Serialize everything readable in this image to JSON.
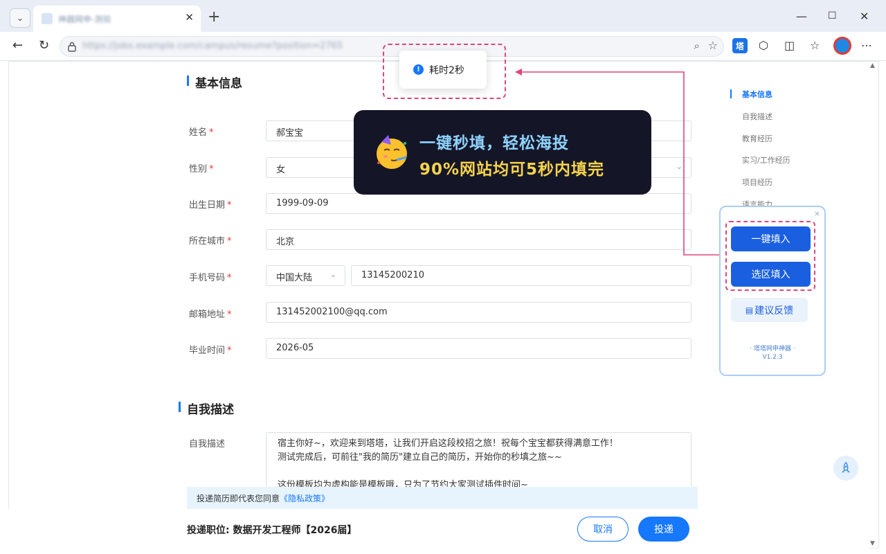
{
  "browser": {
    "tab_title": "神器网申-测验",
    "url": "https://jobs.example.com/campus/resume?position=2765",
    "tab_dropdown_icon": "chevron-down-icon",
    "new_tab": "+",
    "extension_label": "塔"
  },
  "toast": {
    "text": "耗时2秒"
  },
  "promo": {
    "line1": "一键秒填，轻松海投",
    "line2": "90%网站均可5秒内填完",
    "colors": {
      "line1": "#8fd3ff",
      "line2": "#f7d34a",
      "bg": "#141628"
    }
  },
  "sections": {
    "basic_title": "基本信息",
    "self_title": "自我描述"
  },
  "form": {
    "name": {
      "label": "姓名",
      "value": "郝宝宝"
    },
    "gender": {
      "label": "性别",
      "value": "女"
    },
    "birth": {
      "label": "出生日期",
      "value": "1999-09-09"
    },
    "city": {
      "label": "所在城市",
      "value": "北京"
    },
    "phone": {
      "label": "手机号码",
      "region": "中国大陆",
      "value": "13145200210"
    },
    "email": {
      "label": "邮箱地址",
      "value": "131452002100@qq.com"
    },
    "graduation": {
      "label": "毕业时间",
      "value": "2026-05"
    },
    "required_mark": "*"
  },
  "self_desc": {
    "label": "自我描述",
    "line1": "宿主你好~，欢迎来到塔塔，让我们开启这段校招之旅！祝每个宝宝都获得满意工作！",
    "line2": "测试完成后，可前往\"我的简历\"建立自己的简历，开始你的秒填之旅~~",
    "line3": "这份模板均为虚构能是模板哦，只为了节约大家测试插件时间~"
  },
  "agreement": {
    "text": "投递简历即代表您同意",
    "link": "《隐私政策》"
  },
  "footer": {
    "position": "投递职位: 数据开发工程师【2026届】",
    "cancel": "取消",
    "submit": "投递"
  },
  "anchor_nav": {
    "items": [
      "基本信息",
      "自我描述",
      "教育经历",
      "实习/工作经历",
      "项目经历",
      "语言能力"
    ],
    "active": "基本信息"
  },
  "widget": {
    "close": "×",
    "fill_all": "一键填入",
    "fill_region": "选区填入",
    "feedback": "建议反馈",
    "brand": "· 塔塔网申神器 ·",
    "version": "V1.2.3"
  },
  "colors": {
    "accent": "#1677ff",
    "highlight": "#e0457b"
  }
}
